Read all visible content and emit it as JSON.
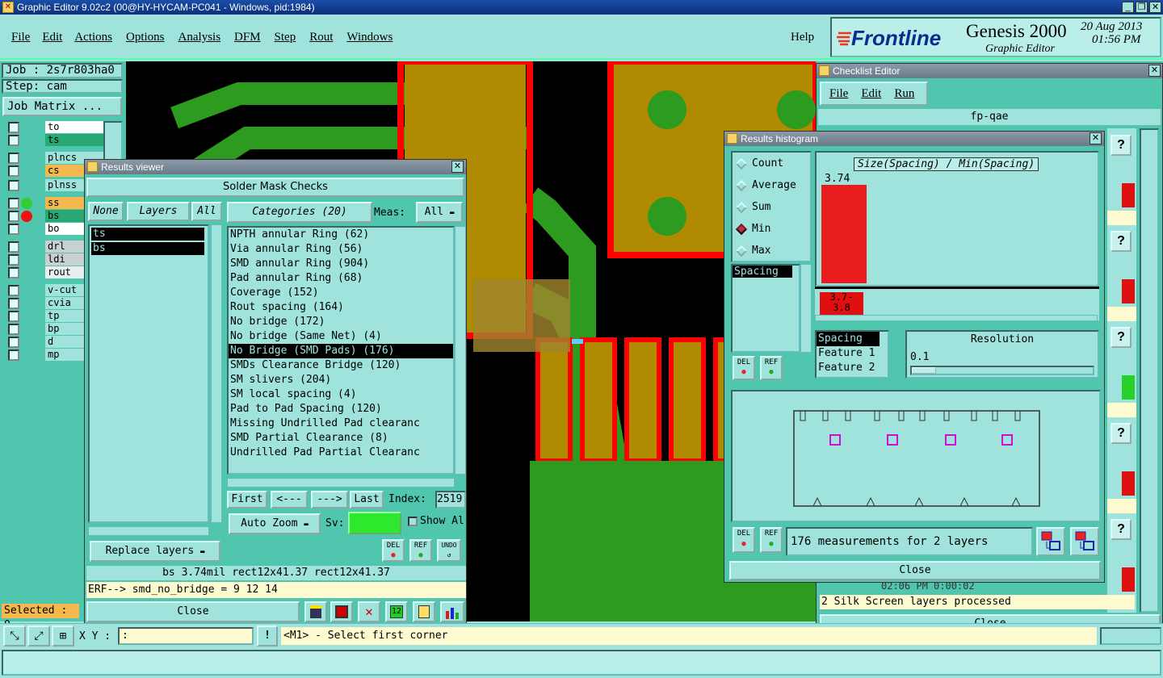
{
  "main_window": {
    "title": "Graphic Editor 9.02c2 (00@HY-HYCAM-PC041 - Windows, pid:1984)",
    "menu": [
      "File",
      "Edit",
      "Actions",
      "Options",
      "Analysis",
      "DFM",
      "Step",
      "Rout",
      "Windows"
    ],
    "help": "Help",
    "brand": "Frontline",
    "product": "Genesis 2000",
    "subtitle": "Graphic Editor",
    "date": "20 Aug 2013",
    "time": "01:56 PM"
  },
  "left_panel": {
    "job": "Job : 2s7r803ha0",
    "step": "Step: cam",
    "job_matrix": "Job Matrix ...",
    "layers": [
      {
        "name": "to",
        "color": "#ffffff"
      },
      {
        "name": "ts",
        "color": "#2aa872"
      },
      {
        "name": "plncs",
        "color": "#9fe3dc"
      },
      {
        "name": "cs",
        "color": "#f5b84c"
      },
      {
        "name": "plnss",
        "color": "#9fe3dc"
      },
      {
        "name": "ss",
        "color": "#f5b84c"
      },
      {
        "name": "bs",
        "color": "#2aa872"
      },
      {
        "name": "bo",
        "color": "#ffffff"
      },
      {
        "name": "drl",
        "color": "#c8d0d0"
      },
      {
        "name": "ldi",
        "color": "#c8d0d0"
      },
      {
        "name": "rout",
        "color": "#e6f0f0"
      },
      {
        "name": "v-cut",
        "color": "#9fe3dc"
      },
      {
        "name": "cvia",
        "color": "#9fe3dc"
      },
      {
        "name": "tp",
        "color": "#9fe3dc"
      },
      {
        "name": "bp",
        "color": "#9fe3dc"
      },
      {
        "name": "d",
        "color": "#9fe3dc"
      },
      {
        "name": "mp",
        "color": "#9fe3dc"
      }
    ],
    "selected": "Selected : 0"
  },
  "results_viewer": {
    "title": "Results viewer",
    "header": "Solder Mask Checks",
    "none": "None",
    "layers_label": "Layers",
    "all": "All",
    "categories_label": "Categories (20)",
    "meas_label": "Meas:",
    "meas_value": "All",
    "layer_list": [
      "ts",
      "bs"
    ],
    "categories": [
      "NPTH annular Ring (62)",
      "Via annular Ring (56)",
      "SMD annular Ring (904)",
      "Pad annular Ring (68)",
      "Coverage (152)",
      "Rout spacing (164)",
      "No bridge (172)",
      "No bridge (Same Net) (4)",
      "No Bridge (SMD Pads) (176)",
      "SMDs Clearance Bridge (120)",
      "SM slivers (204)",
      "SM local spacing (4)",
      "Pad to Pad Spacing (120)",
      "Missing Undrilled Pad clearanc",
      "SMD Partial Clearance (8)",
      "Undrilled Pad Partial Clearanc"
    ],
    "selected_category": 8,
    "first": "First",
    "prev": "<---",
    "next": "--->",
    "last": "Last",
    "index_label": "Index:",
    "index_value": "2519",
    "auto_zoom": "Auto Zoom",
    "sv_label": "Sv:",
    "show_all": "Show Al",
    "replace_layers": "Replace layers",
    "del": "DEL",
    "ref": "REF",
    "undo": "UNDO",
    "status": "bs 3.74mil  rect12x41.37  rect12x41.37",
    "erf": "ERF--> smd_no_bridge = 9 12 14",
    "close": "Close"
  },
  "bottom_bar": {
    "xy_label": "X Y :",
    "xy_value": ":",
    "message": "<M1> - Select first corner"
  },
  "checklist_editor": {
    "title": "Checklist Editor",
    "menu": [
      "File",
      "Edit",
      "Run"
    ],
    "name": "fp-qae",
    "time_row": "02:06 PM    0:00:02",
    "status": "2 Silk Screen layers processed",
    "close": "Close"
  },
  "results_histogram": {
    "title": "Results histogram",
    "options": [
      "Count",
      "Average",
      "Sum",
      "Min",
      "Max"
    ],
    "selected_option": "Min",
    "measure_list": [
      "Spacing"
    ],
    "chart_title": "Size(Spacing) / Min(Spacing)",
    "bar_value": "3.74",
    "bar_label": "3.7-\n3.8",
    "axis_list": [
      "Spacing",
      "Feature 1",
      "Feature 2"
    ],
    "resolution_label": "Resolution",
    "resolution_value": "0.1",
    "measurements": "176 measurements for 2 layers",
    "del": "DEL",
    "ref": "REF",
    "close": "Close",
    "chart_data": {
      "type": "bar",
      "categories": [
        "3.7-3.8"
      ],
      "values": [
        3.74
      ],
      "title": "Size(Spacing) / Min(Spacing)"
    }
  }
}
